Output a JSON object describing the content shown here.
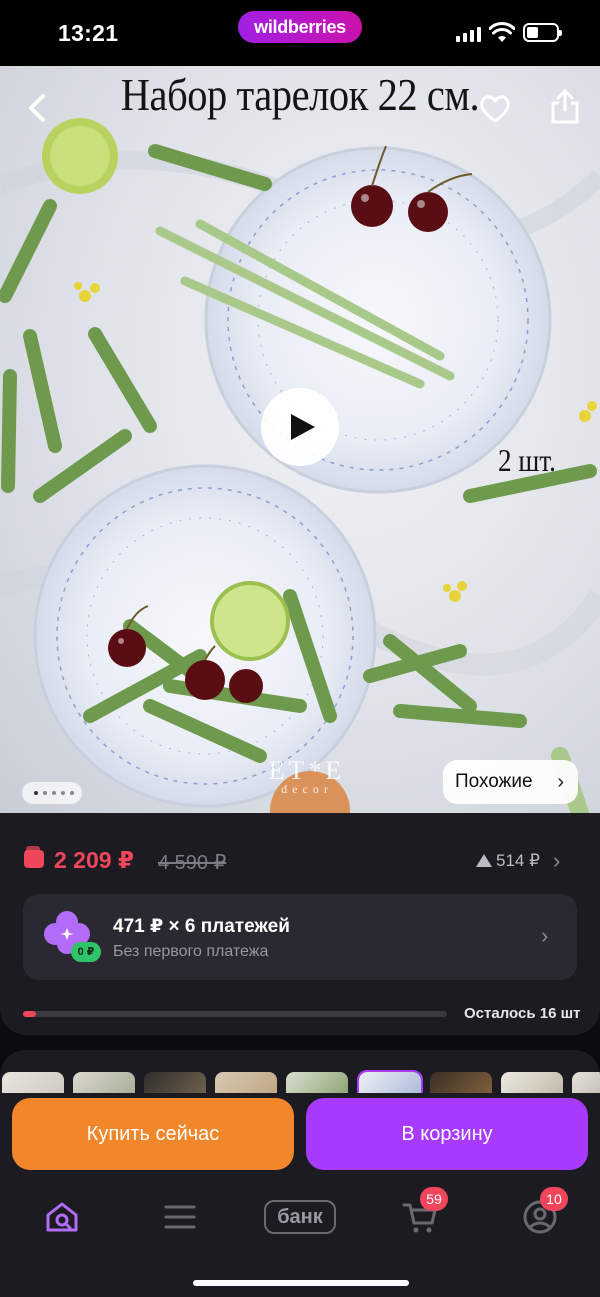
{
  "status_bar": {
    "time": "13:21",
    "brand": "wildberries"
  },
  "product_image": {
    "title_overlay": "Набор тарелок 22 см.",
    "quantity_overlay": "2 шт.",
    "brand_mark": "ET*E",
    "brand_mark_sub": "decor",
    "similar_button": "Похожие",
    "gallery": {
      "total": 5,
      "active": 1
    }
  },
  "price": {
    "current": "2 209 ₽",
    "old": "4 590 ₽",
    "change": "514 ₽",
    "accent_color": "#f0465c"
  },
  "installment": {
    "title": "471 ₽ × 6 платежей",
    "subtitle": "Без первого платежа",
    "badge": "0 ₽"
  },
  "stock": {
    "text": "Осталось 16 шт",
    "fill_fraction": 0.03
  },
  "actions": {
    "buy_now": "Купить сейчас",
    "add_to_cart": "В корзину"
  },
  "tabbar": {
    "items": [
      {
        "name": "home",
        "icon": "home-search-icon"
      },
      {
        "name": "catalog",
        "icon": "menu-icon"
      },
      {
        "name": "bank",
        "label": "банк"
      },
      {
        "name": "cart",
        "icon": "cart-icon",
        "badge": "59"
      },
      {
        "name": "profile",
        "icon": "profile-icon",
        "badge": "10"
      }
    ]
  },
  "colors": {
    "brand_purple": "#a73afd",
    "buy_orange": "#f2862a",
    "panel_bg": "#1c1b22"
  }
}
